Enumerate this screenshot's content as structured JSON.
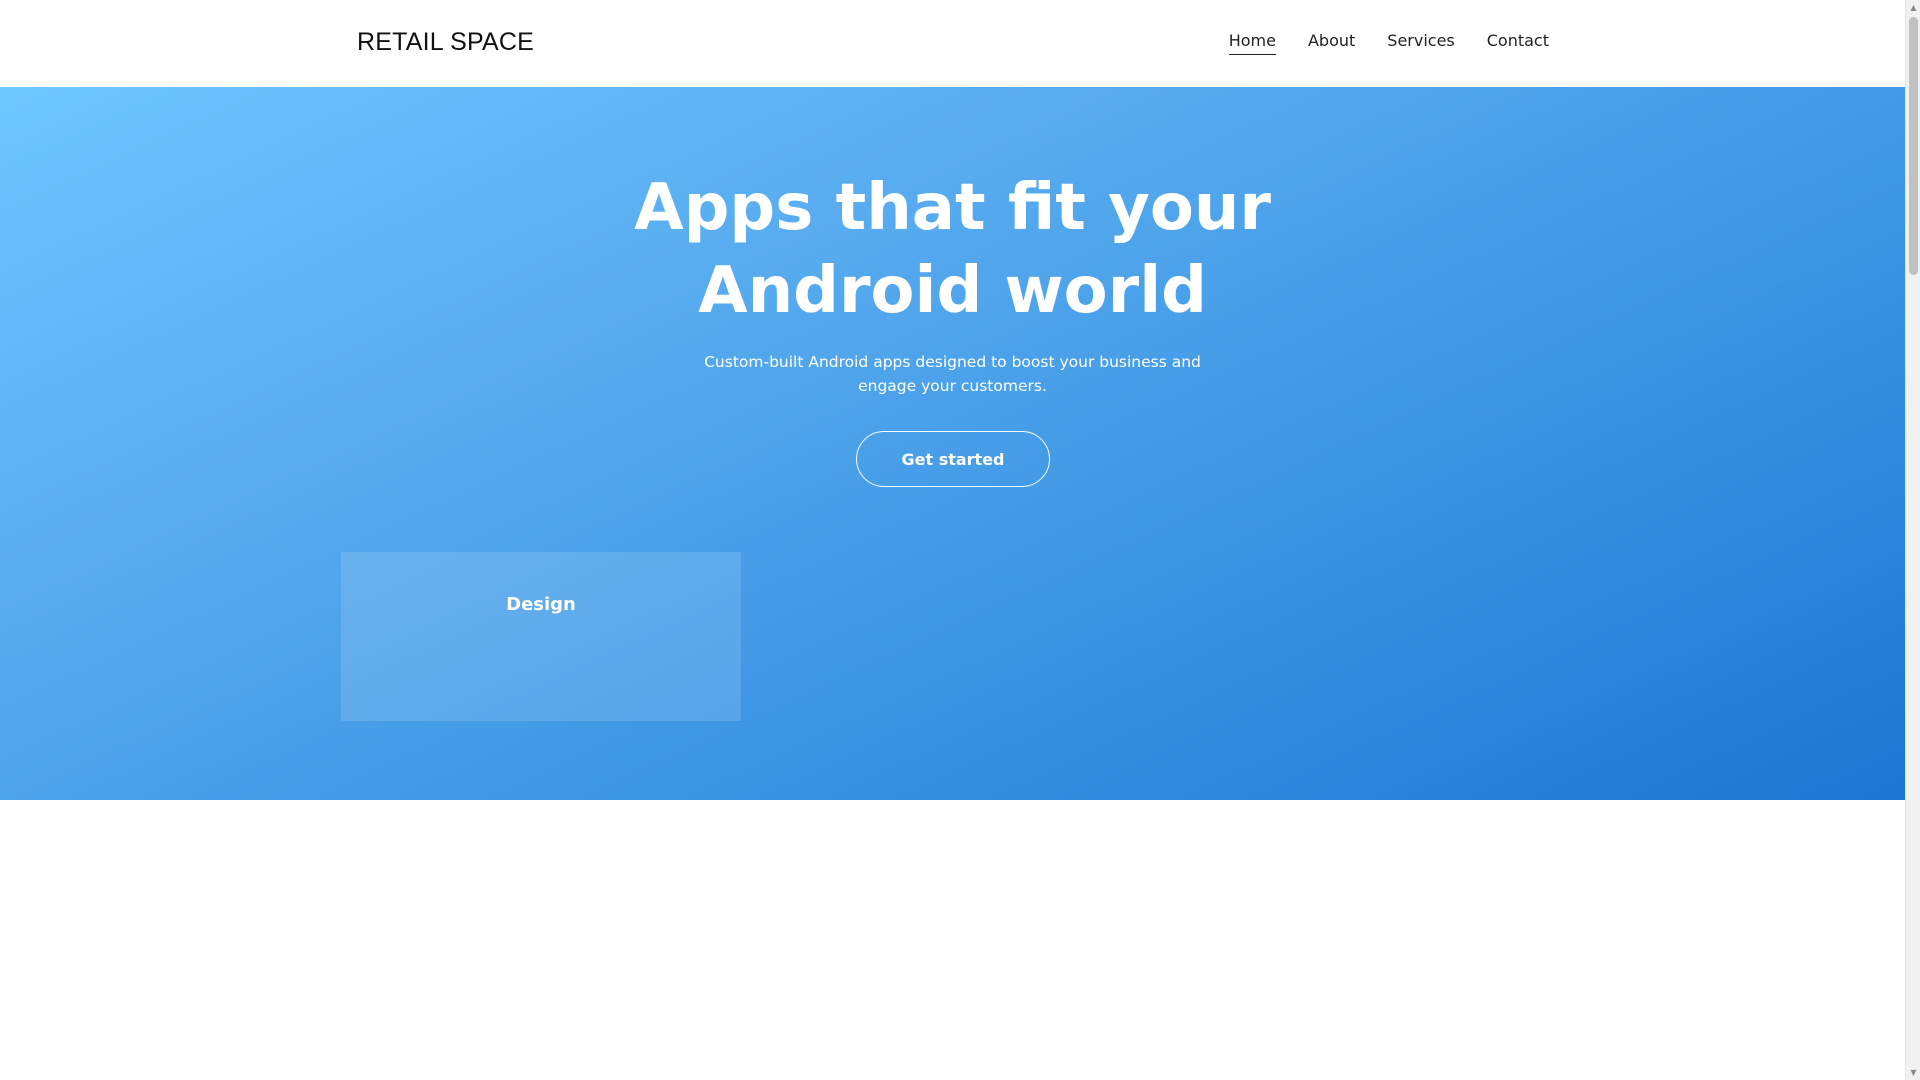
{
  "header": {
    "logo": "RETAIL SPACE",
    "nav": {
      "home": "Home",
      "about": "About",
      "services": "Services",
      "contact": "Contact"
    },
    "active_nav": "Home"
  },
  "hero": {
    "title_line1": "Apps that fit your",
    "title_line2": "Android world",
    "subtitle_line1": "Custom-built Android apps designed to boost your business and",
    "subtitle_line2": "engage your customers.",
    "cta_label": "Get started",
    "card_title": "Design",
    "gradient_colors": [
      "#6ec6ff",
      "#1c76d2"
    ]
  },
  "scrollbar": {
    "up_icon": "arrow-up-icon",
    "down_icon": "arrow-down-icon"
  }
}
